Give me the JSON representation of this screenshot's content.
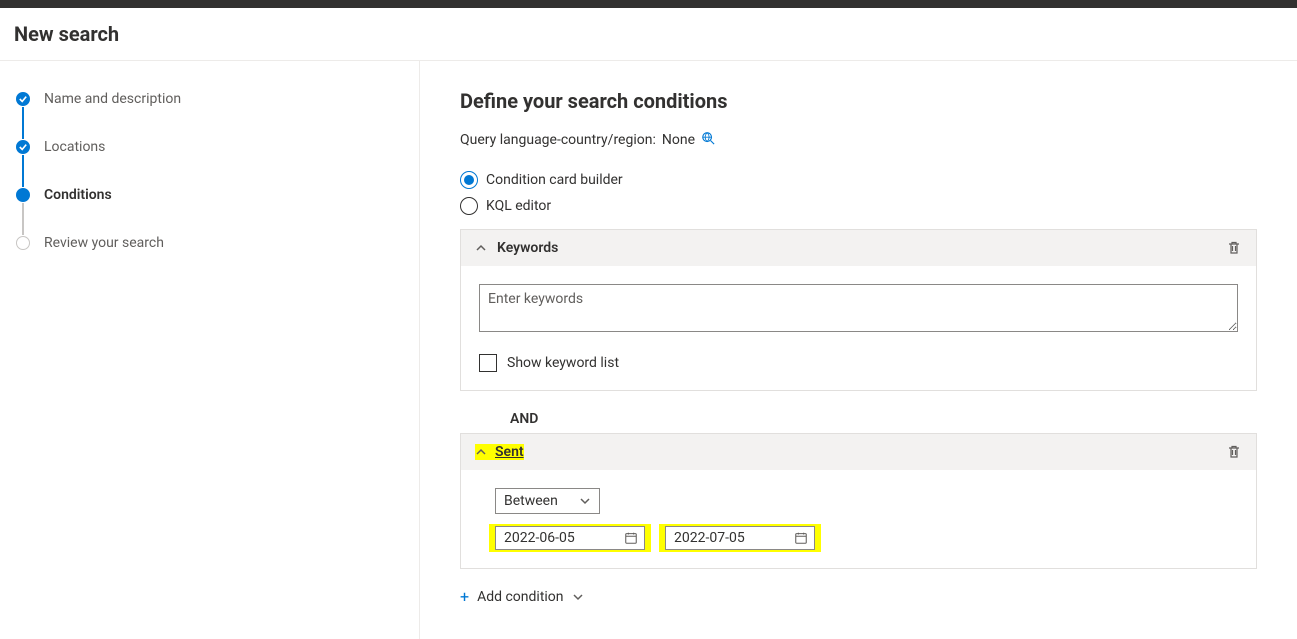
{
  "header": {
    "title": "New search"
  },
  "sidebar": {
    "steps": [
      {
        "label": "Name and description",
        "state": "completed"
      },
      {
        "label": "Locations",
        "state": "completed"
      },
      {
        "label": "Conditions",
        "state": "current"
      },
      {
        "label": "Review your search",
        "state": "pending"
      }
    ]
  },
  "main": {
    "title": "Define your search conditions",
    "query_language_label": "Query language-country/region:",
    "query_language_value": "None",
    "builder_options": {
      "card_builder": "Condition card builder",
      "kql_editor": "KQL editor",
      "selected": "card_builder"
    },
    "keywords_card": {
      "title": "Keywords",
      "placeholder": "Enter keywords",
      "value": "",
      "show_list_label": "Show keyword list",
      "show_list_checked": false
    },
    "and_label": "AND",
    "sent_card": {
      "title": "Sent",
      "operator_options": [
        "Between"
      ],
      "operator_selected": "Between",
      "date_from": "2022-06-05",
      "date_to": "2022-07-05"
    },
    "add_condition_label": "Add condition"
  }
}
